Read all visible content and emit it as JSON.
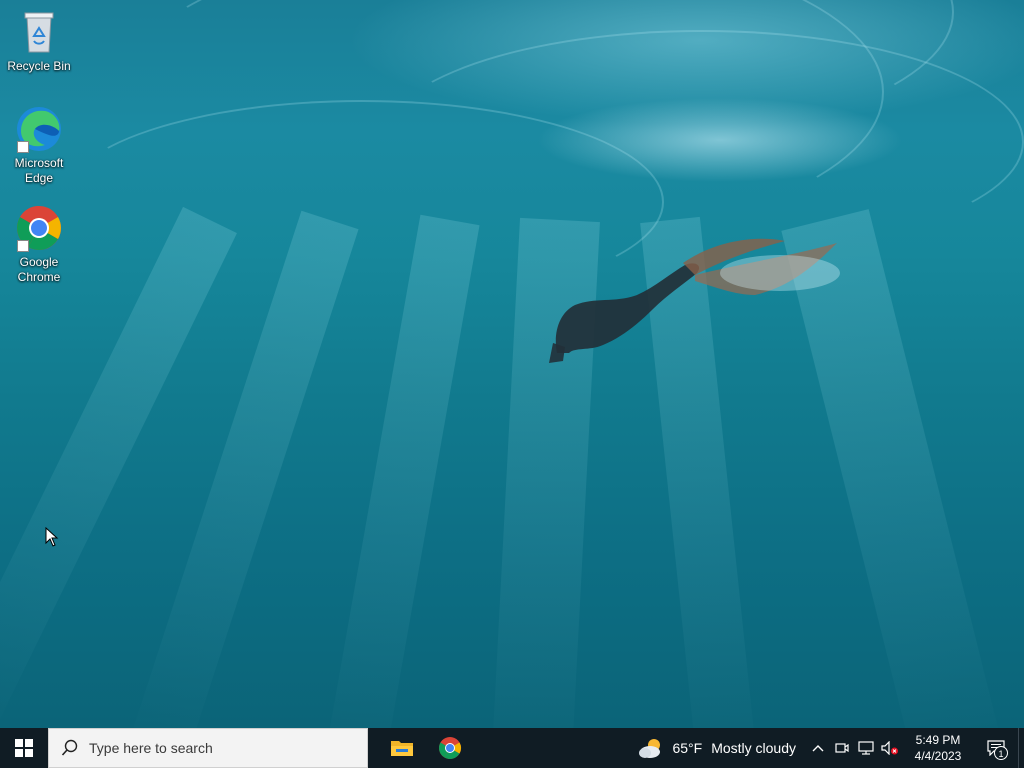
{
  "desktop": {
    "icons": [
      {
        "label": "Recycle Bin"
      },
      {
        "label": "Microsoft Edge"
      },
      {
        "label": "Google Chrome"
      }
    ]
  },
  "taskbar": {
    "search_placeholder": "Type here to search",
    "pinned_apps": [
      "file-explorer",
      "google-chrome"
    ],
    "weather": {
      "temperature": "65°F",
      "condition": "Mostly cloudy"
    },
    "clock": {
      "time": "5:49 PM",
      "date": "4/4/2023"
    },
    "notifications_count": "1"
  },
  "colors": {
    "taskbar": "#101c24",
    "water": "#137f97",
    "search_box": "#f3f3f3"
  }
}
